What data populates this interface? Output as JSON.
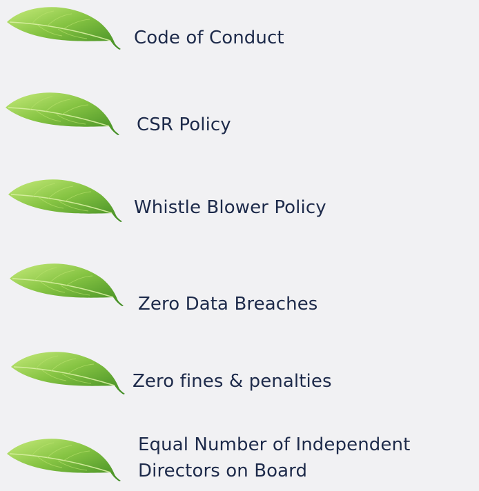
{
  "items": [
    {
      "label": "Code of Conduct"
    },
    {
      "label": "CSR Policy"
    },
    {
      "label": "Whistle Blower Policy"
    },
    {
      "label": "Zero Data Breaches"
    },
    {
      "label": "Zero fines & penalties"
    },
    {
      "label": "Equal Number of Independent Directors on Board"
    }
  ],
  "icons": {
    "bullet": "leaf-icon"
  },
  "colors": {
    "background": "#f1f1f3",
    "text": "#1d2a4a",
    "leaf_light": "#a7d957",
    "leaf_mid": "#6fb23a",
    "leaf_dark": "#3d7d1f"
  }
}
